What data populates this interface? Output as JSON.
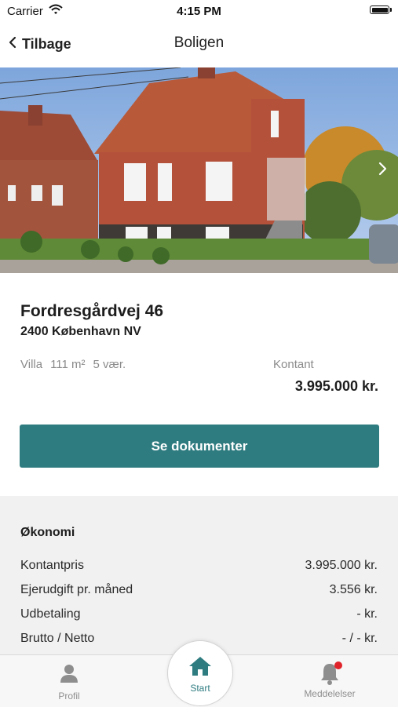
{
  "status_bar": {
    "carrier": "Carrier",
    "time": "4:15 PM"
  },
  "nav": {
    "back_label": "Tilbage",
    "title": "Boligen"
  },
  "property": {
    "street": "Fordresgårdvej 46",
    "postal": "2400 København NV",
    "type": "Villa",
    "area": "111 m²",
    "rooms": "5 vær.",
    "price_label": "Kontant",
    "price": "3.995.000 kr."
  },
  "cta": {
    "label": "Se dokumenter"
  },
  "economy": {
    "title": "Økonomi",
    "rows": [
      {
        "label": "Kontantpris",
        "value": "3.995.000 kr."
      },
      {
        "label": "Ejerudgift pr. måned",
        "value": "3.556 kr."
      },
      {
        "label": "Udbetaling",
        "value": "- kr."
      },
      {
        "label": "Brutto / Netto",
        "value": "- / - kr."
      }
    ]
  },
  "tabs": {
    "profil": "Profil",
    "start": "Start",
    "meddelelser": "Meddelelser"
  },
  "colors": {
    "accent": "#2f7c80",
    "badge": "#e0232a"
  },
  "icons": [
    "wifi-icon",
    "battery-icon",
    "chevron-left-icon",
    "chevron-right-icon",
    "person-icon",
    "home-icon",
    "bell-icon"
  ]
}
